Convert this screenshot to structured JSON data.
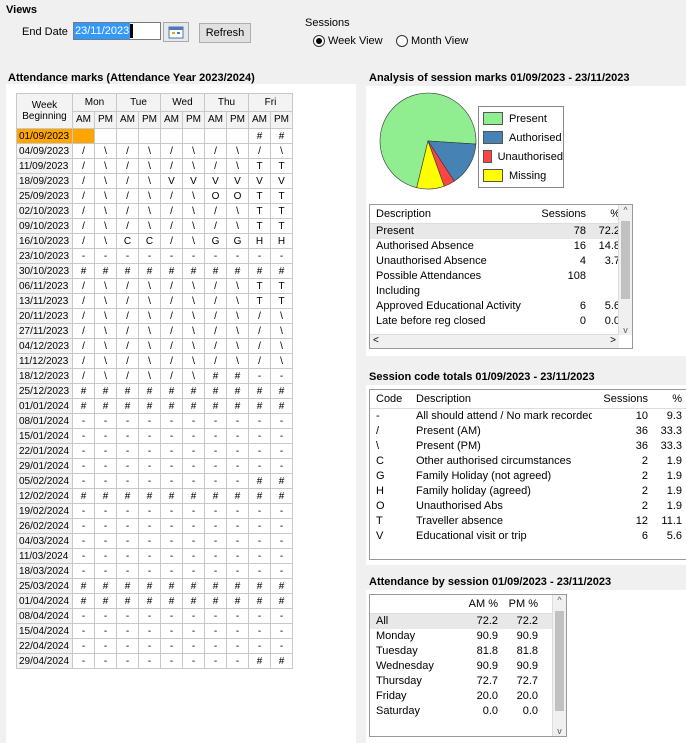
{
  "views": {
    "title": "Views",
    "end_date_label": "End Date",
    "end_date_value": "23/11/2023",
    "refresh_label": "Refresh",
    "sessions_label": "Sessions",
    "week_view_label": "Week View",
    "month_view_label": "Month View",
    "selected_view": "week"
  },
  "attendance": {
    "title": "Attendance marks (Attendance Year 2023/2024)",
    "week_header": "Week Beginning",
    "days": [
      "Mon",
      "Tue",
      "Wed",
      "Thu",
      "Fri"
    ],
    "am": "AM",
    "pm": "PM",
    "rows": [
      {
        "week": "01/09/2023",
        "marks": [
          "",
          "",
          "",
          "",
          "",
          "",
          "",
          "",
          "#",
          "#"
        ]
      },
      {
        "week": "04/09/2023",
        "marks": [
          "/",
          "\\",
          "/",
          "\\",
          "/",
          "\\",
          "/",
          "\\",
          "/",
          "\\"
        ]
      },
      {
        "week": "11/09/2023",
        "marks": [
          "/",
          "\\",
          "/",
          "\\",
          "/",
          "\\",
          "/",
          "\\",
          "T",
          "T"
        ]
      },
      {
        "week": "18/09/2023",
        "marks": [
          "/",
          "\\",
          "/",
          "\\",
          "V",
          "V",
          "V",
          "V",
          "V",
          "V"
        ]
      },
      {
        "week": "25/09/2023",
        "marks": [
          "/",
          "\\",
          "/",
          "\\",
          "/",
          "\\",
          "O",
          "O",
          "T",
          "T"
        ]
      },
      {
        "week": "02/10/2023",
        "marks": [
          "/",
          "\\",
          "/",
          "\\",
          "/",
          "\\",
          "/",
          "\\",
          "T",
          "T"
        ]
      },
      {
        "week": "09/10/2023",
        "marks": [
          "/",
          "\\",
          "/",
          "\\",
          "/",
          "\\",
          "/",
          "\\",
          "T",
          "T"
        ]
      },
      {
        "week": "16/10/2023",
        "marks": [
          "/",
          "\\",
          "C",
          "C",
          "/",
          "\\",
          "G",
          "G",
          "H",
          "H"
        ]
      },
      {
        "week": "23/10/2023",
        "marks": [
          "-",
          "-",
          "-",
          "-",
          "-",
          "-",
          "-",
          "-",
          "-",
          "-"
        ]
      },
      {
        "week": "30/10/2023",
        "marks": [
          "#",
          "#",
          "#",
          "#",
          "#",
          "#",
          "#",
          "#",
          "#",
          "#"
        ]
      },
      {
        "week": "06/11/2023",
        "marks": [
          "/",
          "\\",
          "/",
          "\\",
          "/",
          "\\",
          "/",
          "\\",
          "T",
          "T"
        ]
      },
      {
        "week": "13/11/2023",
        "marks": [
          "/",
          "\\",
          "/",
          "\\",
          "/",
          "\\",
          "/",
          "\\",
          "T",
          "T"
        ]
      },
      {
        "week": "20/11/2023",
        "marks": [
          "/",
          "\\",
          "/",
          "\\",
          "/",
          "\\",
          "/",
          "\\",
          "/",
          "\\"
        ]
      },
      {
        "week": "27/11/2023",
        "marks": [
          "/",
          "\\",
          "/",
          "\\",
          "/",
          "\\",
          "/",
          "\\",
          "/",
          "\\"
        ]
      },
      {
        "week": "04/12/2023",
        "marks": [
          "/",
          "\\",
          "/",
          "\\",
          "/",
          "\\",
          "/",
          "\\",
          "/",
          "\\"
        ]
      },
      {
        "week": "11/12/2023",
        "marks": [
          "/",
          "\\",
          "/",
          "\\",
          "/",
          "\\",
          "/",
          "\\",
          "/",
          "\\"
        ]
      },
      {
        "week": "18/12/2023",
        "marks": [
          "/",
          "\\",
          "/",
          "\\",
          "/",
          "\\",
          "#",
          "#",
          "-",
          "-"
        ]
      },
      {
        "week": "25/12/2023",
        "marks": [
          "#",
          "#",
          "#",
          "#",
          "#",
          "#",
          "#",
          "#",
          "#",
          "#"
        ]
      },
      {
        "week": "01/01/2024",
        "marks": [
          "#",
          "#",
          "#",
          "#",
          "#",
          "#",
          "#",
          "#",
          "#",
          "#"
        ]
      },
      {
        "week": "08/01/2024",
        "marks": [
          "-",
          "-",
          "-",
          "-",
          "-",
          "-",
          "-",
          "-",
          "-",
          "-"
        ]
      },
      {
        "week": "15/01/2024",
        "marks": [
          "-",
          "-",
          "-",
          "-",
          "-",
          "-",
          "-",
          "-",
          "-",
          "-"
        ]
      },
      {
        "week": "22/01/2024",
        "marks": [
          "-",
          "-",
          "-",
          "-",
          "-",
          "-",
          "-",
          "-",
          "-",
          "-"
        ]
      },
      {
        "week": "29/01/2024",
        "marks": [
          "-",
          "-",
          "-",
          "-",
          "-",
          "-",
          "-",
          "-",
          "-",
          "-"
        ]
      },
      {
        "week": "05/02/2024",
        "marks": [
          "-",
          "-",
          "-",
          "-",
          "-",
          "-",
          "-",
          "-",
          "#",
          "#"
        ]
      },
      {
        "week": "12/02/2024",
        "marks": [
          "#",
          "#",
          "#",
          "#",
          "#",
          "#",
          "#",
          "#",
          "#",
          "#"
        ]
      },
      {
        "week": "19/02/2024",
        "marks": [
          "-",
          "-",
          "-",
          "-",
          "-",
          "-",
          "-",
          "-",
          "-",
          "-"
        ]
      },
      {
        "week": "26/02/2024",
        "marks": [
          "-",
          "-",
          "-",
          "-",
          "-",
          "-",
          "-",
          "-",
          "-",
          "-"
        ]
      },
      {
        "week": "04/03/2024",
        "marks": [
          "-",
          "-",
          "-",
          "-",
          "-",
          "-",
          "-",
          "-",
          "-",
          "-"
        ]
      },
      {
        "week": "11/03/2024",
        "marks": [
          "-",
          "-",
          "-",
          "-",
          "-",
          "-",
          "-",
          "-",
          "-",
          "-"
        ]
      },
      {
        "week": "18/03/2024",
        "marks": [
          "-",
          "-",
          "-",
          "-",
          "-",
          "-",
          "-",
          "-",
          "-",
          "-"
        ]
      },
      {
        "week": "25/03/2024",
        "marks": [
          "#",
          "#",
          "#",
          "#",
          "#",
          "#",
          "#",
          "#",
          "#",
          "#"
        ]
      },
      {
        "week": "01/04/2024",
        "marks": [
          "#",
          "#",
          "#",
          "#",
          "#",
          "#",
          "#",
          "#",
          "#",
          "#"
        ]
      },
      {
        "week": "08/04/2024",
        "marks": [
          "-",
          "-",
          "-",
          "-",
          "-",
          "-",
          "-",
          "-",
          "-",
          "-"
        ]
      },
      {
        "week": "15/04/2024",
        "marks": [
          "-",
          "-",
          "-",
          "-",
          "-",
          "-",
          "-",
          "-",
          "-",
          "-"
        ]
      },
      {
        "week": "22/04/2024",
        "marks": [
          "-",
          "-",
          "-",
          "-",
          "-",
          "-",
          "-",
          "-",
          "-",
          "-"
        ]
      },
      {
        "week": "29/04/2024",
        "marks": [
          "-",
          "-",
          "-",
          "-",
          "-",
          "-",
          "-",
          "-",
          "#",
          "#"
        ]
      }
    ]
  },
  "analysis": {
    "title": "Analysis of session marks 01/09/2023 - 23/11/2023",
    "legend": [
      {
        "label": "Present",
        "color": "#90ee90"
      },
      {
        "label": "Authorised",
        "color": "#4682b4"
      },
      {
        "label": "Unauthorised",
        "color": "#ff4444"
      },
      {
        "label": "Missing",
        "color": "#ffff00"
      }
    ],
    "pie_values": [
      78,
      16,
      4,
      10
    ],
    "table_headers": [
      "Description",
      "Sessions",
      "%"
    ],
    "rows": [
      {
        "desc": "Present",
        "sessions": "78",
        "pct": "72.2"
      },
      {
        "desc": "Authorised Absence",
        "sessions": "16",
        "pct": "14.8"
      },
      {
        "desc": "Unauthorised Absence",
        "sessions": "4",
        "pct": "3.7"
      },
      {
        "desc": "Possible Attendances",
        "sessions": "108",
        "pct": ""
      },
      {
        "desc": "Including",
        "sessions": "",
        "pct": ""
      },
      {
        "desc": "Approved Educational Activity",
        "sessions": "6",
        "pct": "5.6"
      },
      {
        "desc": "Late before reg closed",
        "sessions": "0",
        "pct": "0.0"
      }
    ]
  },
  "session_codes": {
    "title": "Session code totals 01/09/2023 - 23/11/2023",
    "headers": [
      "Code",
      "Description",
      "Sessions",
      "%"
    ],
    "rows": [
      {
        "code": "-",
        "desc": "All should attend / No mark recorded",
        "sessions": "10",
        "pct": "9.3"
      },
      {
        "code": "/",
        "desc": "Present (AM)",
        "sessions": "36",
        "pct": "33.3"
      },
      {
        "code": "\\",
        "desc": "Present (PM)",
        "sessions": "36",
        "pct": "33.3"
      },
      {
        "code": "C",
        "desc": "Other authorised circumstances",
        "sessions": "2",
        "pct": "1.9"
      },
      {
        "code": "G",
        "desc": "Family Holiday (not agreed)",
        "sessions": "2",
        "pct": "1.9"
      },
      {
        "code": "H",
        "desc": "Family holiday (agreed)",
        "sessions": "2",
        "pct": "1.9"
      },
      {
        "code": "O",
        "desc": "Unauthorised Abs",
        "sessions": "2",
        "pct": "1.9"
      },
      {
        "code": "T",
        "desc": "Traveller absence",
        "sessions": "12",
        "pct": "11.1"
      },
      {
        "code": "V",
        "desc": "Educational visit or trip",
        "sessions": "6",
        "pct": "5.6"
      }
    ]
  },
  "by_session": {
    "title": "Attendance by session 01/09/2023 - 23/11/2023",
    "headers": [
      "",
      "AM %",
      "PM %"
    ],
    "rows": [
      {
        "label": "All",
        "am": "72.2",
        "pm": "72.2"
      },
      {
        "label": "Monday",
        "am": "90.9",
        "pm": "90.9"
      },
      {
        "label": "Tuesday",
        "am": "81.8",
        "pm": "81.8"
      },
      {
        "label": "Wednesday",
        "am": "90.9",
        "pm": "90.9"
      },
      {
        "label": "Thursday",
        "am": "72.7",
        "pm": "72.7"
      },
      {
        "label": "Friday",
        "am": "20.0",
        "pm": "20.0"
      },
      {
        "label": "Saturday",
        "am": "0.0",
        "pm": "0.0"
      }
    ]
  }
}
